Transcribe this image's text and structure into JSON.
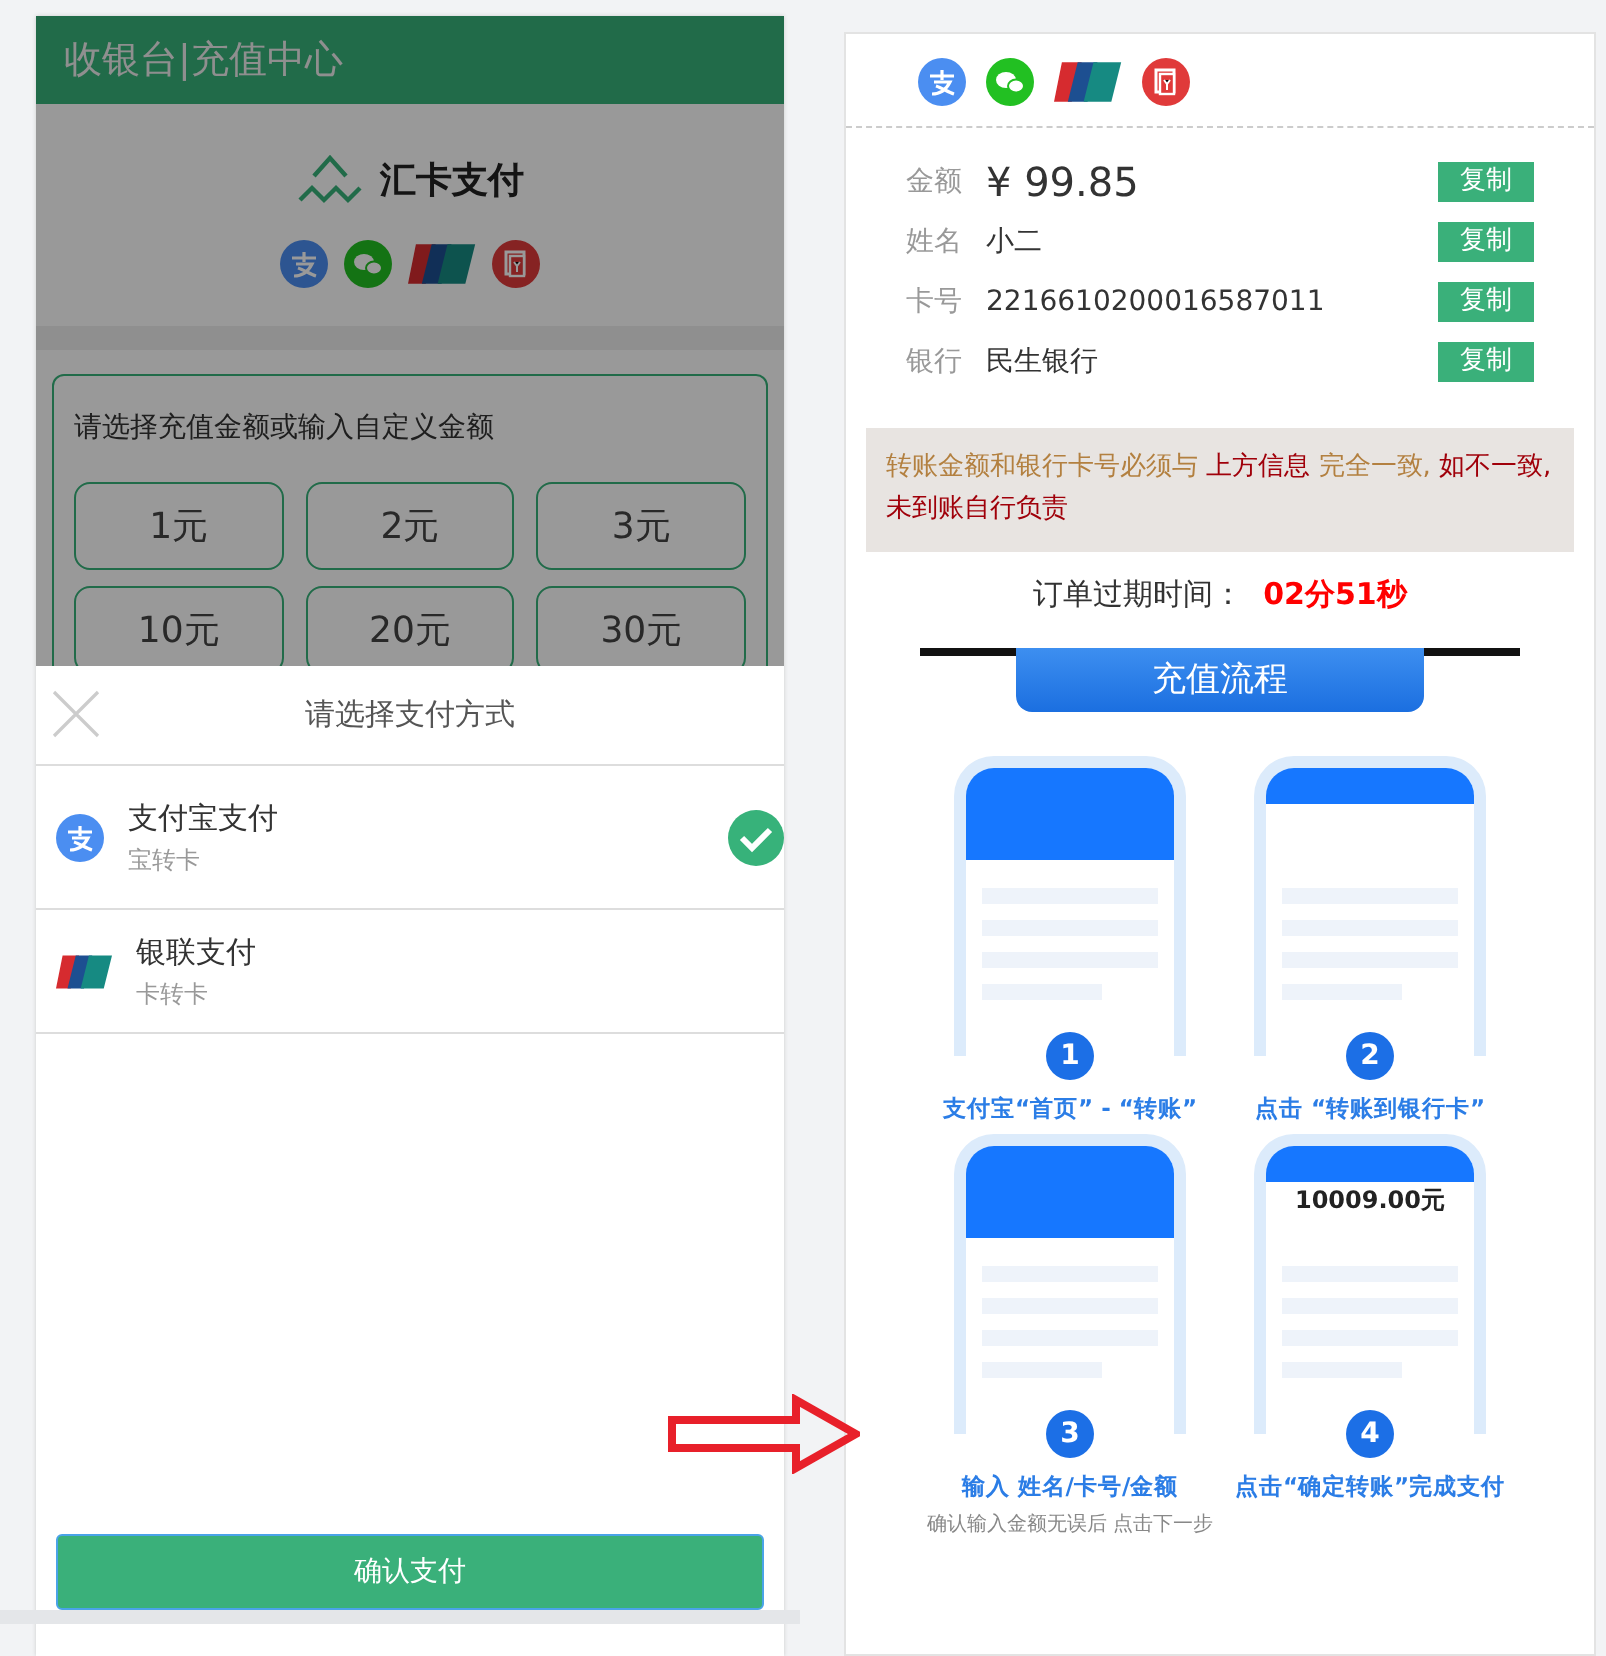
{
  "cashier": {
    "header_title": "收银台|充值中心",
    "brand": "汇卡支付",
    "prompt": "请选择充值金额或输入自定义金额",
    "amounts": [
      "1元",
      "2元",
      "3元",
      "10元",
      "20元",
      "30元"
    ]
  },
  "payment_sheet": {
    "title": "请选择支付方式",
    "methods": [
      {
        "name": "支付宝支付",
        "subtitle": "宝转卡",
        "kind": "alipay",
        "selected": true
      },
      {
        "name": "银联支付",
        "subtitle": "卡转卡",
        "kind": "unionpay",
        "selected": false
      }
    ],
    "confirm_button": "确认支付"
  },
  "transfer": {
    "fields": [
      {
        "label": "金额",
        "value": "¥ 99.85",
        "kind": "amount",
        "button": "复制"
      },
      {
        "label": "姓名",
        "value": "小二",
        "kind": "text",
        "button": "复制"
      },
      {
        "label": "卡号",
        "value": "2216610200016587011",
        "kind": "text",
        "button": "复制"
      },
      {
        "label": "银行",
        "value": "民生银行",
        "kind": "text",
        "button": "复制"
      }
    ],
    "notice": [
      {
        "text": "转账金额和银行卡号必须与 ",
        "emphasis": false
      },
      {
        "text": "上方信息",
        "emphasis": true
      },
      {
        "text": " 完全一致, ",
        "emphasis": false
      },
      {
        "text": "如不一致, 未到账自行负责",
        "emphasis": true
      }
    ],
    "expiry_label": "订单过期时间：",
    "expiry_value": "02分51秒"
  },
  "guide": {
    "title": "充值流程",
    "steps": [
      {
        "number": "1",
        "caption": "支付宝“首页” - “转账”"
      },
      {
        "number": "2",
        "caption": "点击 “转账到银行卡”"
      },
      {
        "number": "3",
        "caption": "输入 姓名/卡号/金额",
        "note": "确认输入金额无误后 点击下一步"
      },
      {
        "number": "4",
        "caption": "点击“确定转账”完成支付"
      }
    ],
    "sample_screen_amount": "10009.00元"
  }
}
